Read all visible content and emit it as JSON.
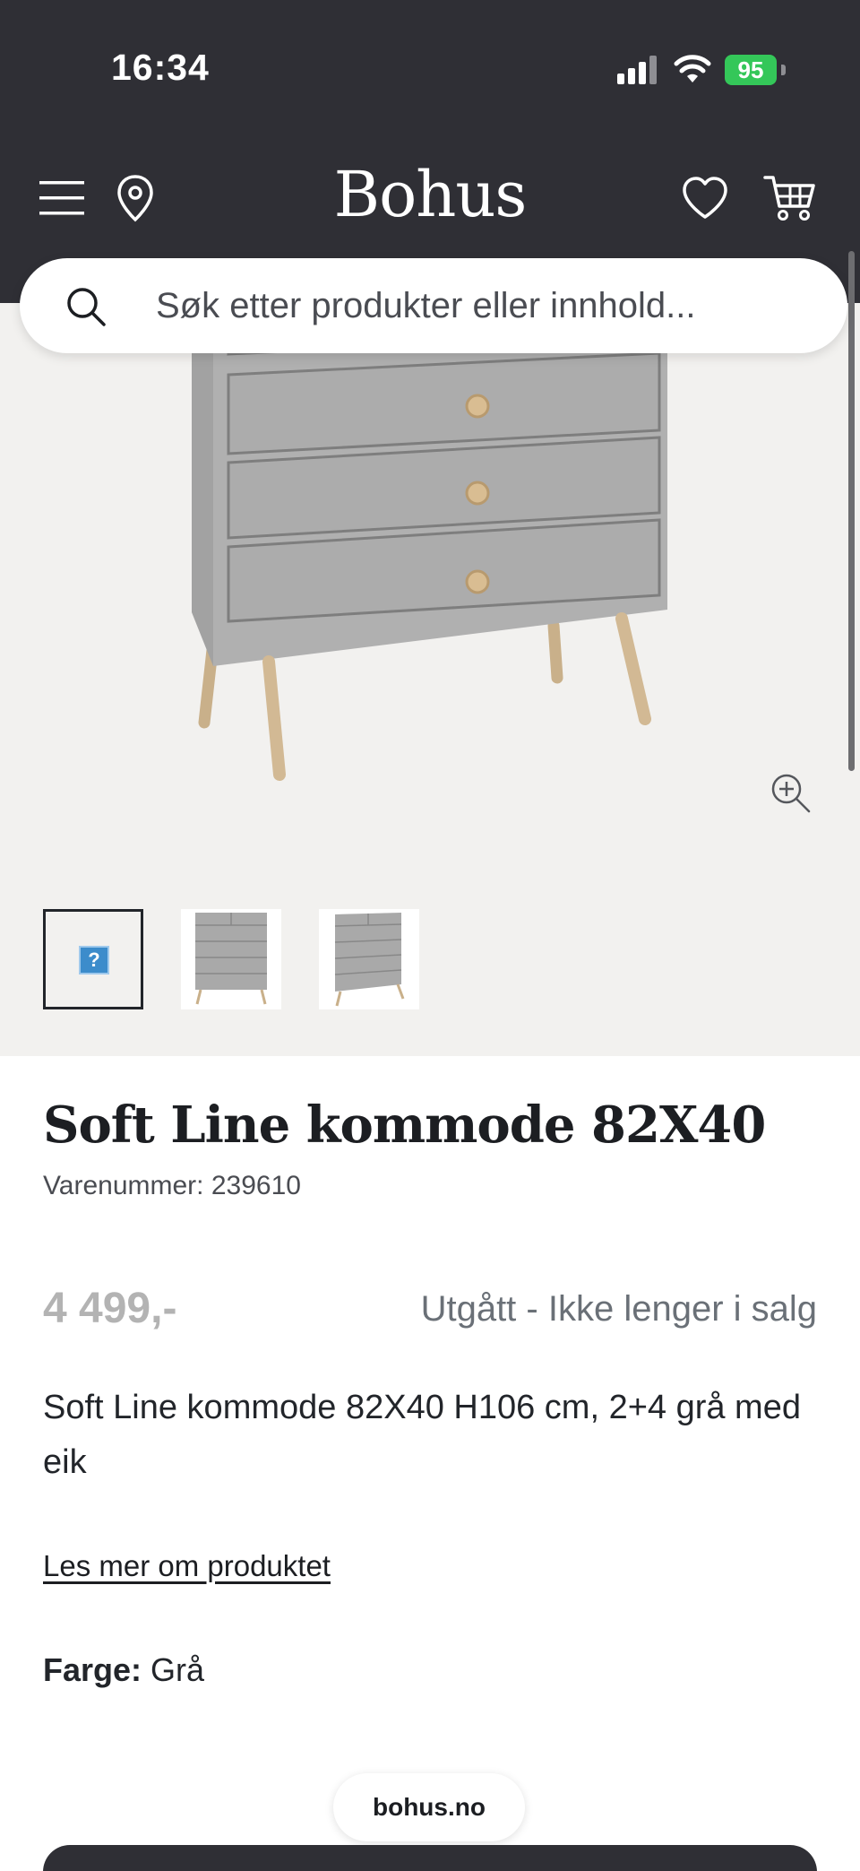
{
  "status_bar": {
    "time": "16:34",
    "battery": "95"
  },
  "header": {
    "logo": "Bohus"
  },
  "search": {
    "placeholder": "Søk etter produkter eller innhold..."
  },
  "gallery": {
    "thumbnails": [
      "product-thumbnail-placeholder",
      "chest-front-view",
      "chest-angle-view"
    ]
  },
  "product": {
    "title": "Soft Line kommode 82X40",
    "sku": "Varenummer: 239610",
    "price": "4 499,-",
    "availability": "Utgått - Ikke lenger i salg",
    "description": "Soft Line kommode 82X40 H106 cm, 2+4 grå med eik",
    "read_more": "Les mer om produktet",
    "color_label": "Farge:",
    "color_value": "Grå"
  },
  "browser": {
    "url": "bohus.no"
  },
  "colors": {
    "header_bg": "#2f2f35",
    "gallery_bg": "#f2f1ef",
    "availability": "#6a7077",
    "price": "#b3b3b3"
  }
}
